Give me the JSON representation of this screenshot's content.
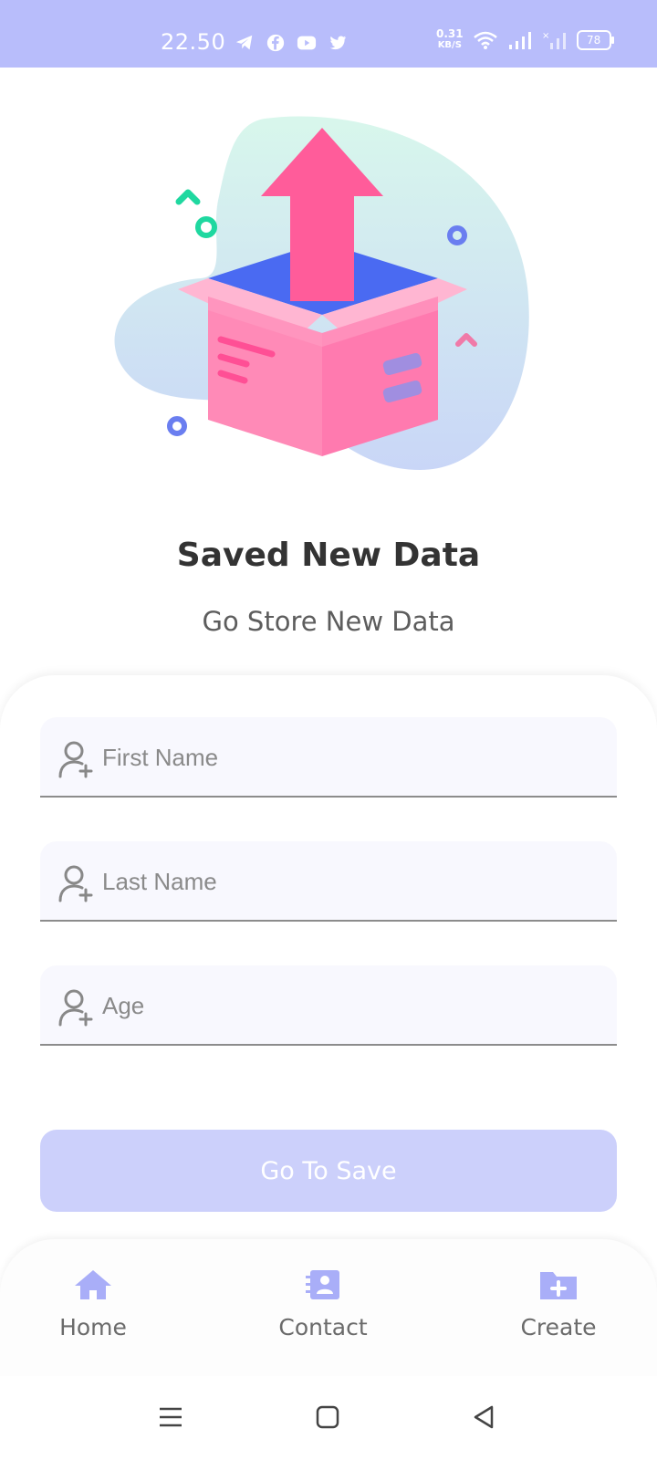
{
  "status_bar": {
    "time": "22.50",
    "net_speed_value": "0.31",
    "net_speed_unit": "KB/S",
    "battery": "78",
    "background": "#b8bdfb"
  },
  "header": {
    "title": "Saved New Data",
    "subtitle": "Go Store New Data"
  },
  "form": {
    "fields": [
      {
        "placeholder": "First Name",
        "icon": "user-plus-icon"
      },
      {
        "placeholder": "Last Name",
        "icon": "user-plus-icon"
      },
      {
        "placeholder": "Age",
        "icon": "user-plus-icon"
      }
    ],
    "submit_label": "Go To Save"
  },
  "bottom_nav": {
    "items": [
      {
        "label": "Home",
        "icon": "home-icon"
      },
      {
        "label": "Contact",
        "icon": "contact-card-icon"
      },
      {
        "label": "Create",
        "icon": "folder-plus-icon"
      }
    ]
  },
  "colors": {
    "accent": "#a9aef8",
    "button": "#ccd0fb",
    "title": "#333333"
  }
}
